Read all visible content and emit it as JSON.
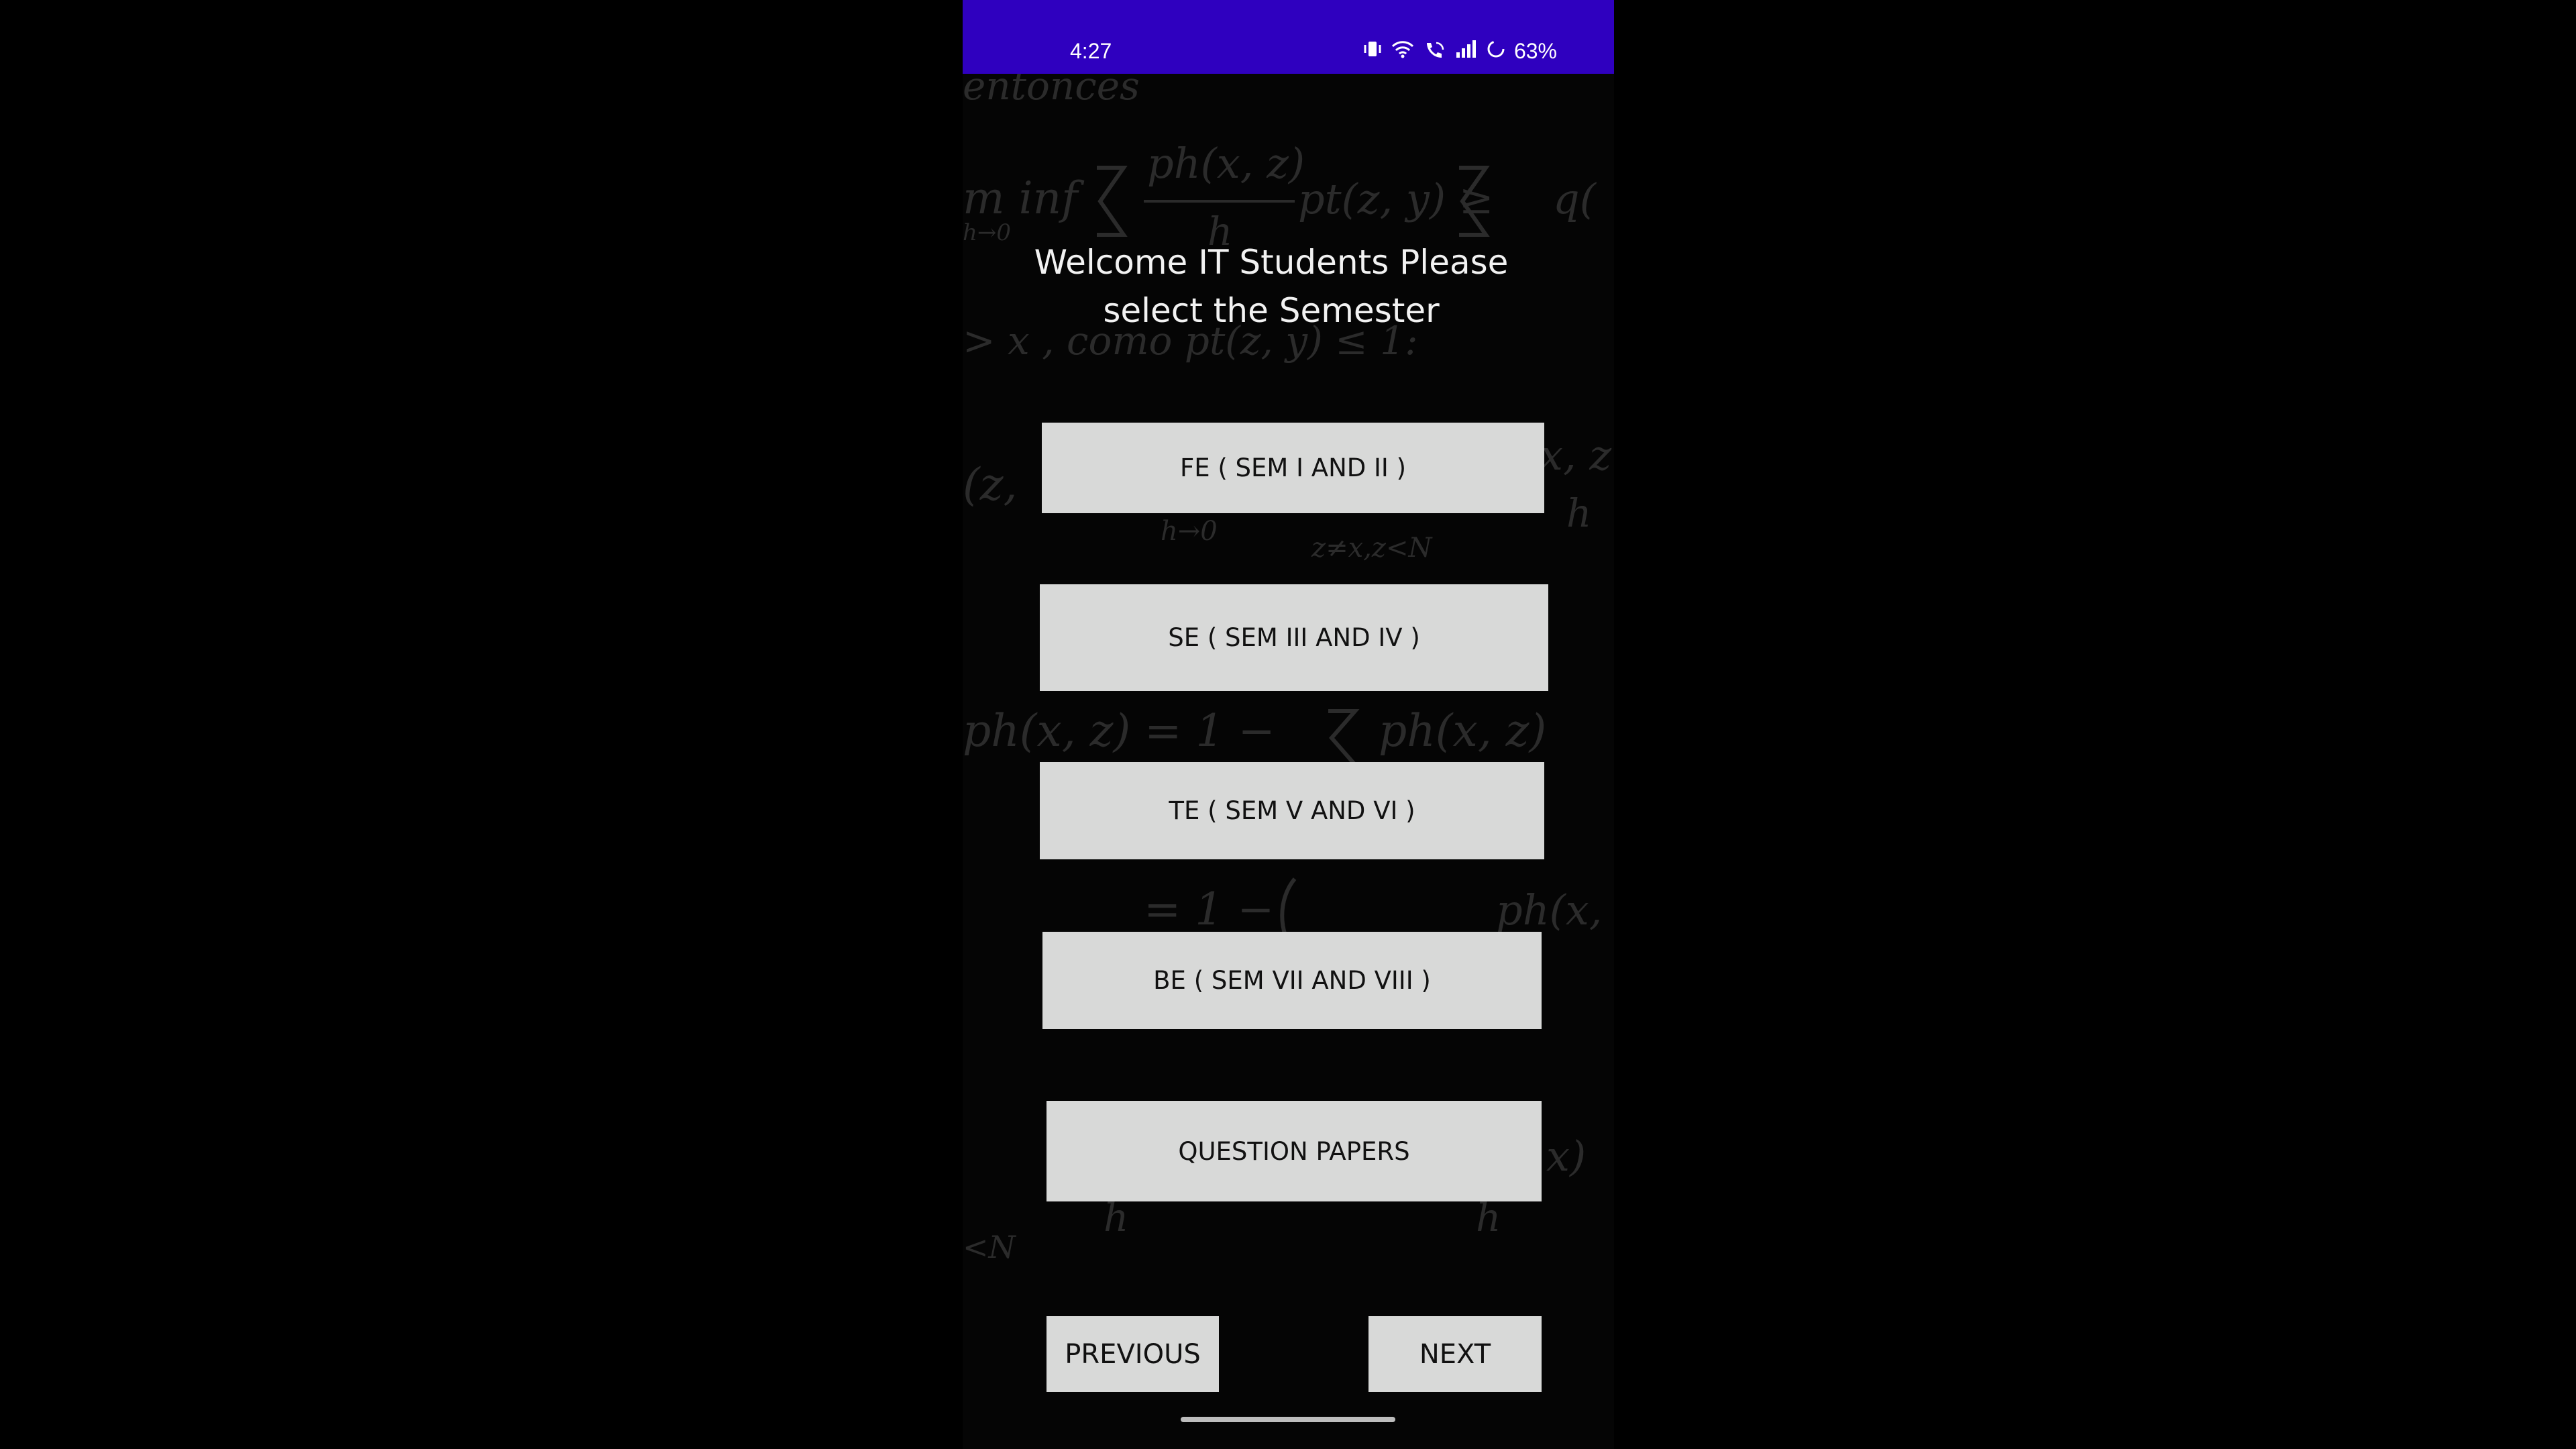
{
  "status_bar": {
    "time": "4:27",
    "battery": "63%",
    "icons": [
      "vibrate-icon",
      "wifi-icon",
      "wifi-calling-icon",
      "signal-icon",
      "battery-icon"
    ]
  },
  "background_text": {
    "lines": [
      "entonces",
      "m inf",
      "h→0",
      "ph(x, z)",
      "h",
      "pt(z, y) ≥",
      "q(",
      "> x , como pt(z, y) ≤ 1:",
      "(z,",
      "h→0",
      "z≠x,z<N",
      "x, z",
      "h",
      "ph(x, z)   =   1 −",
      "ph(x, z)",
      "=   1 −",
      "ph(x,",
      "x)",
      "h",
      "h",
      "<N"
    ]
  },
  "main": {
    "title_line1": "Welcome IT  Students Please",
    "title_line2": "select the Semester",
    "buttons": [
      {
        "label": "FE ( SEM I AND II )"
      },
      {
        "label": "SE ( SEM III AND  IV )"
      },
      {
        "label": "TE ( SEM V AND VI )"
      },
      {
        "label": "BE ( SEM VII AND VIII )"
      },
      {
        "label": "QUESTION PAPERS"
      }
    ],
    "previous_label": "PREVIOUS",
    "next_label": "NEXT"
  },
  "colors": {
    "status_bar": "#2f00bf",
    "button": "#d8d9d8",
    "background": "#050505"
  }
}
